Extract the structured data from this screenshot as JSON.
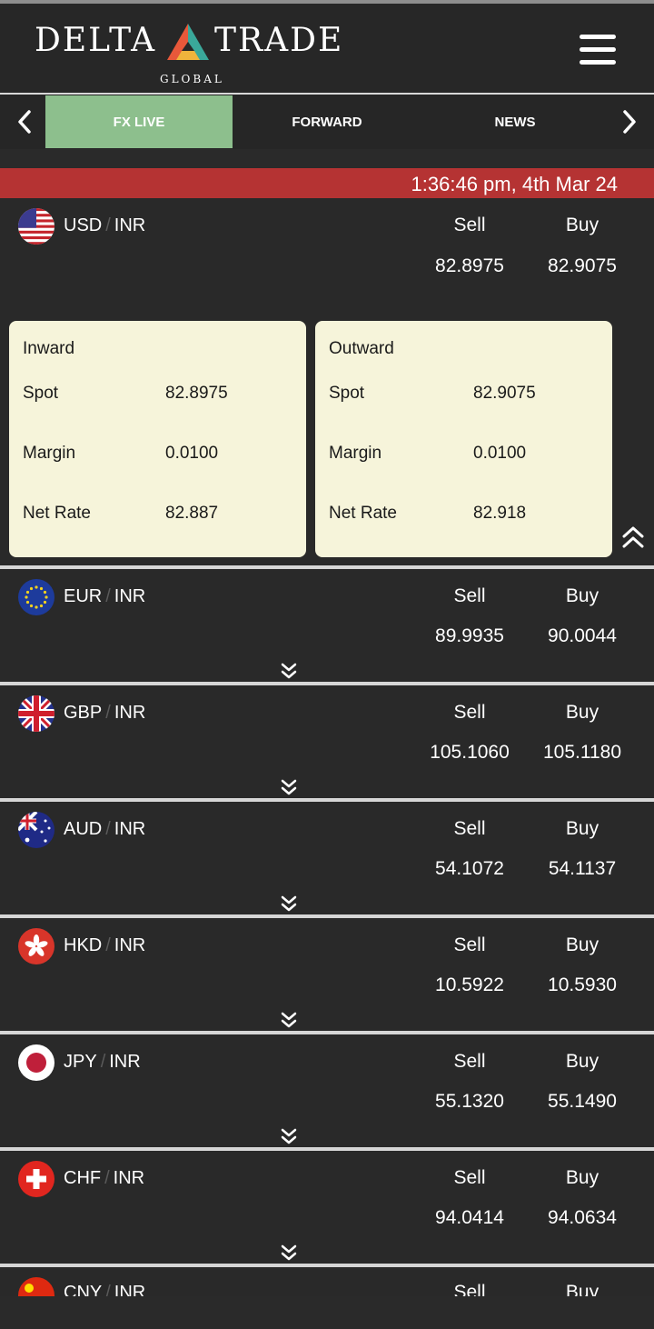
{
  "brand": {
    "left": "DELTA",
    "right": "TRADE",
    "sub": "GLOBAL"
  },
  "tabs": [
    {
      "label": "FX LIVE",
      "active": true
    },
    {
      "label": "FORWARD",
      "active": false
    },
    {
      "label": "NEWS",
      "active": false
    }
  ],
  "timestamp": "1:36:46 pm, 4th Mar 24",
  "columns": {
    "sell": "Sell",
    "buy": "Buy"
  },
  "pairs": [
    {
      "base": "USD",
      "quote": "INR",
      "sell": "82.8975",
      "buy": "82.9075",
      "flag": "us-flag-icon"
    },
    {
      "base": "EUR",
      "quote": "INR",
      "sell": "89.9935",
      "buy": "90.0044",
      "flag": "eu-flag-icon"
    },
    {
      "base": "GBP",
      "quote": "INR",
      "sell": "105.1060",
      "buy": "105.1180",
      "flag": "uk-flag-icon"
    },
    {
      "base": "AUD",
      "quote": "INR",
      "sell": "54.1072",
      "buy": "54.1137",
      "flag": "au-flag-icon"
    },
    {
      "base": "HKD",
      "quote": "INR",
      "sell": "10.5922",
      "buy": "10.5930",
      "flag": "hk-flag-icon"
    },
    {
      "base": "JPY",
      "quote": "INR",
      "sell": "55.1320",
      "buy": "55.1490",
      "flag": "jp-flag-icon"
    },
    {
      "base": "CHF",
      "quote": "INR",
      "sell": "94.0414",
      "buy": "94.0634",
      "flag": "ch-flag-icon"
    },
    {
      "base": "CNY",
      "quote": "INR",
      "sell": "",
      "buy": "",
      "flag": "cn-flag-icon"
    }
  ],
  "detail": {
    "inward": {
      "title": "Inward",
      "spot_label": "Spot",
      "spot": "82.8975",
      "margin_label": "Margin",
      "margin": "0.0100",
      "net_label": "Net Rate",
      "net": "82.887"
    },
    "outward": {
      "title": "Outward",
      "spot_label": "Spot",
      "spot": "82.9075",
      "margin_label": "Margin",
      "margin": "0.0100",
      "net_label": "Net Rate",
      "net": "82.918"
    }
  },
  "colors": {
    "accent_tab": "#8dbf8d",
    "time_bar": "#b53333",
    "card_bg": "#f6f4da",
    "background": "#2a2a2a"
  }
}
